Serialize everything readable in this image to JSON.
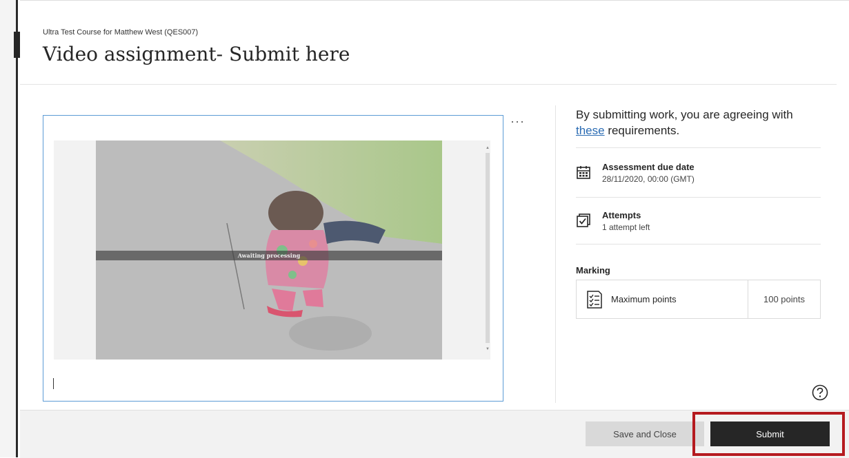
{
  "header": {
    "course_name": "Ultra Test Course for Matthew West (QES007)",
    "title": "Video assignment- Submit here",
    "close_glyph": "‹"
  },
  "editor": {
    "processing_text": "Awaiting processing",
    "more_glyph": "···"
  },
  "sidebar": {
    "agreement_before": "By submitting work, you are agreeing with ",
    "agreement_link": "these",
    "agreement_after": " requirements.",
    "due_date_label": "Assessment due date",
    "due_date_value": "28/11/2020, 00:00 (GMT)",
    "attempts_label": "Attempts",
    "attempts_value": "1 attempt left",
    "marking_title": "Marking",
    "max_points_label": "Maximum points",
    "max_points_value": "100 points"
  },
  "footer": {
    "save_label": "Save and Close",
    "submit_label": "Submit"
  },
  "icons": {
    "calendar": "calendar-icon",
    "attempts": "checkbox-stack-icon",
    "points": "checklist-icon",
    "help": "help-icon"
  },
  "colors": {
    "link": "#2a6bb3",
    "submit_bg": "#262626",
    "highlight": "#b51a1f",
    "editor_border": "#5b9bd5"
  }
}
